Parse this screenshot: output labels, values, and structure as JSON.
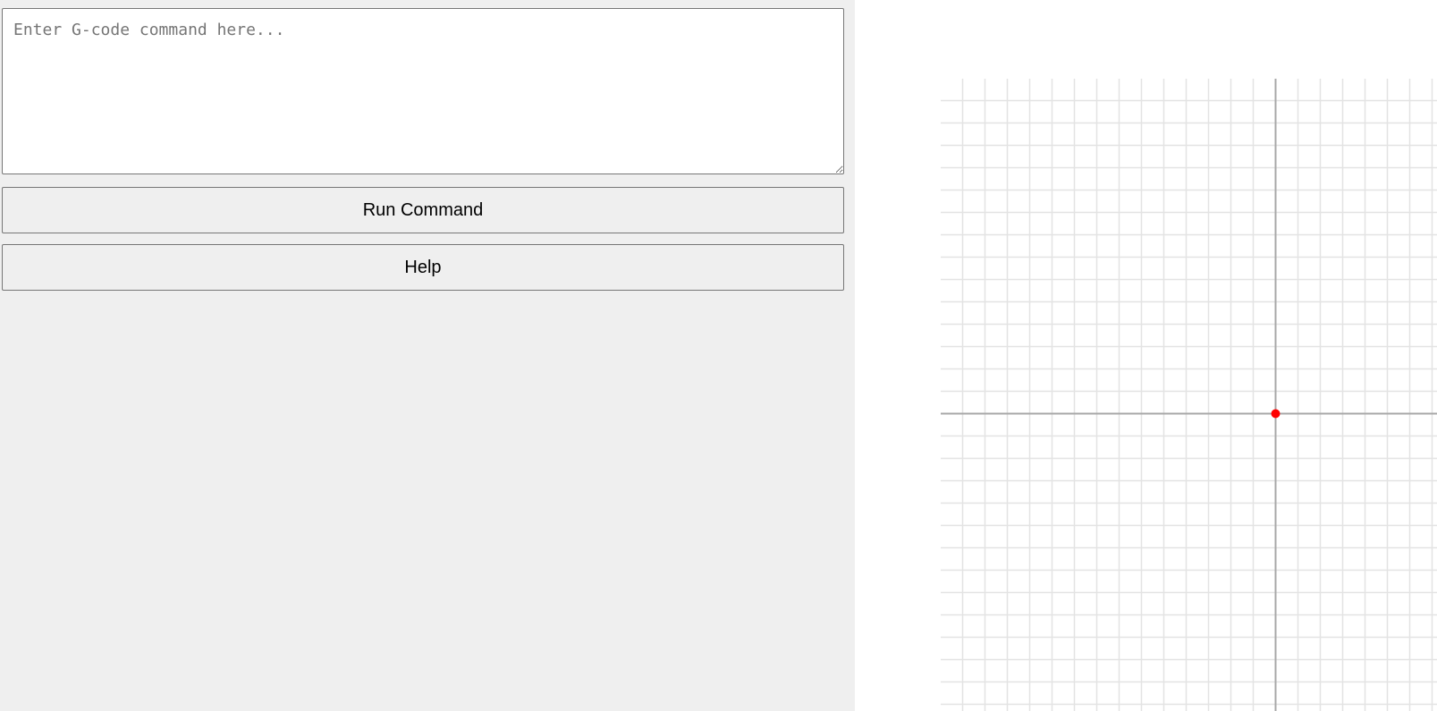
{
  "command_panel": {
    "input": {
      "value": "",
      "placeholder": "Enter G-code command here..."
    },
    "run_button_label": "Run Command",
    "help_button_label": "Help"
  },
  "plot": {
    "origin_marker": {
      "x": 0,
      "y": 0
    },
    "grid": true,
    "colors": {
      "grid_line": "#e3e3e3",
      "axis_line": "#a8a8a8",
      "origin_marker": "#ff0000"
    }
  }
}
